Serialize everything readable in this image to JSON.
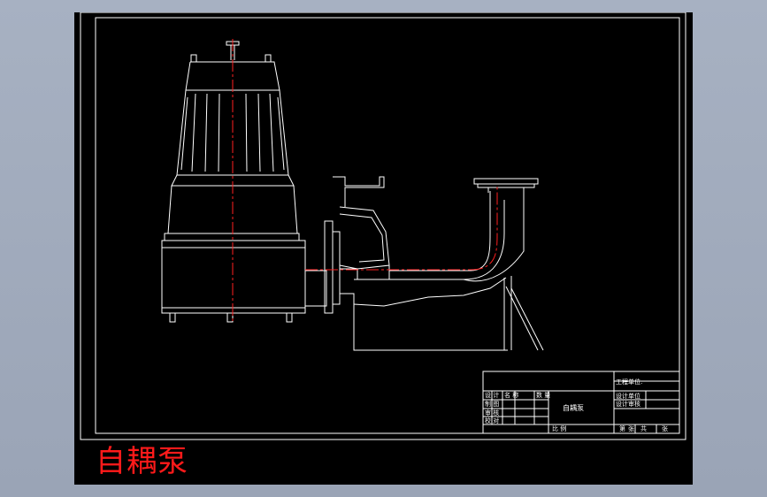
{
  "drawing": {
    "caption": "自耦泵",
    "title_block": {
      "part_name": "自耦泵",
      "unit_label": "工程单位:",
      "design_label": "设计单位",
      "proof_label": "设计审核",
      "scale_label": "比 例",
      "sheet_label": "第",
      "total_label": "张",
      "of_label": "共",
      "sheets_label": "张",
      "rows": [
        "设 计",
        "制 图",
        "审 核",
        "校 对",
        "批 准"
      ],
      "col_labels": [
        "名 称",
        "数 量"
      ]
    },
    "colors": {
      "background": "#000000",
      "lines": "#ffffff",
      "centerline": "#ff2020",
      "caption": "#ff1a1a"
    }
  }
}
